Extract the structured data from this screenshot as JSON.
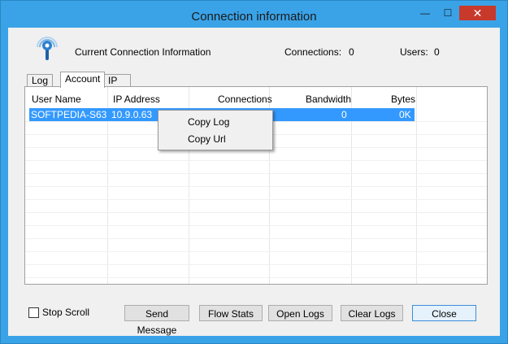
{
  "window": {
    "title": "Connection information",
    "minimize_glyph": "—",
    "maximize_glyph": "☐",
    "close_glyph": "✕"
  },
  "header": {
    "icon": "wireless-signal-icon",
    "text": "Current Connection Information",
    "connections_label": "Connections:",
    "connections_value": "0",
    "users_label": "Users:",
    "users_value": "0"
  },
  "tabs": [
    {
      "label": "Log",
      "active": false
    },
    {
      "label": "Account",
      "active": true
    },
    {
      "label": "IP",
      "active": false
    }
  ],
  "table": {
    "columns": [
      "User Name",
      "IP Address",
      "Connections",
      "Bandwidth",
      "Bytes"
    ],
    "rows": [
      {
        "user_name": "SOFTPEDIA-S63",
        "ip_address": "10.9.0.63",
        "connections": "",
        "bandwidth": "0",
        "bytes": "0K",
        "selected": true
      }
    ]
  },
  "context_menu": {
    "items": [
      "Copy Log",
      "Copy Url"
    ]
  },
  "footer": {
    "stop_scroll_label": "Stop Scroll",
    "stop_scroll_checked": false,
    "buttons": {
      "send_message": "Send Message",
      "flow_stats": "Flow Stats",
      "open_logs": "Open Logs",
      "clear_logs": "Clear Logs",
      "close": "Close"
    }
  },
  "colors": {
    "frame": "#3aa3e8",
    "selection": "#3399ff",
    "close_button": "#c7392b"
  }
}
